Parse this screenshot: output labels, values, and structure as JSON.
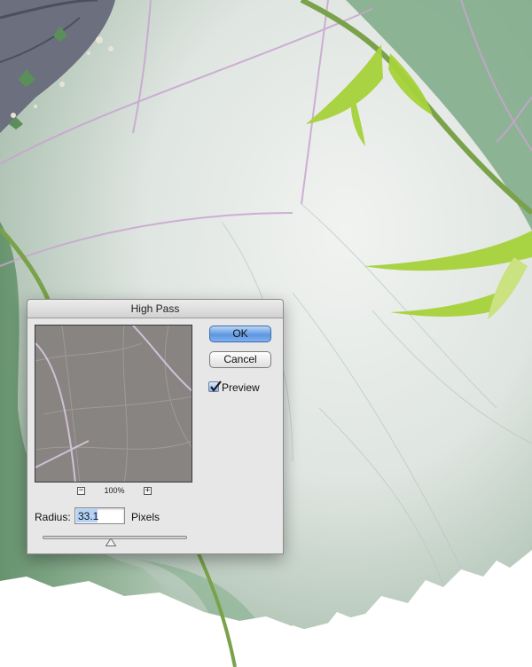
{
  "dialog": {
    "title": "High Pass",
    "ok_label": "OK",
    "cancel_label": "Cancel",
    "preview_label": "Preview",
    "preview_checked": true,
    "zoom_out_symbol": "−",
    "zoom_in_symbol": "+",
    "zoom_level": "100%",
    "radius_label": "Radius:",
    "radius_value": "33.1",
    "units_label": "Pixels",
    "slider_fraction": 0.47
  },
  "icons": {
    "zoom_out": "minus-icon",
    "zoom_in": "plus-icon",
    "check": "checkmark-icon",
    "slider_thumb": "triangle-up-icon"
  },
  "colors": {
    "ok_button": "#5d97e0",
    "leaf_green": "#6f9a72",
    "stem_green": "#7aa24a",
    "sprout_green": "#a6d23a",
    "vein_purple": "#c9a4cf",
    "bleached_leaf": "#e7ebe8",
    "preview_gray": "#878481"
  }
}
